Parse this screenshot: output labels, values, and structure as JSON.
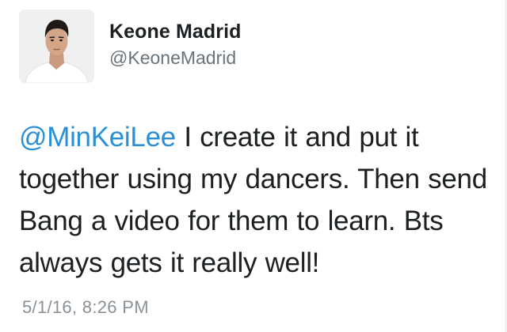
{
  "author": {
    "name": "Keone Madrid",
    "handle": "@KeoneMadrid",
    "avatar_icon": "profile-photo"
  },
  "tweet": {
    "mention": "@MinKeiLee",
    "text": " I create it and put it together using my dancers. Then send Bang a video for them to learn. Bts always gets it really well!",
    "timestamp": "5/1/16, 8:26 PM"
  },
  "colors": {
    "name": "#1c2022",
    "handle": "#69737b",
    "mention": "#2b8fd6",
    "timestamp": "#8a9299"
  }
}
